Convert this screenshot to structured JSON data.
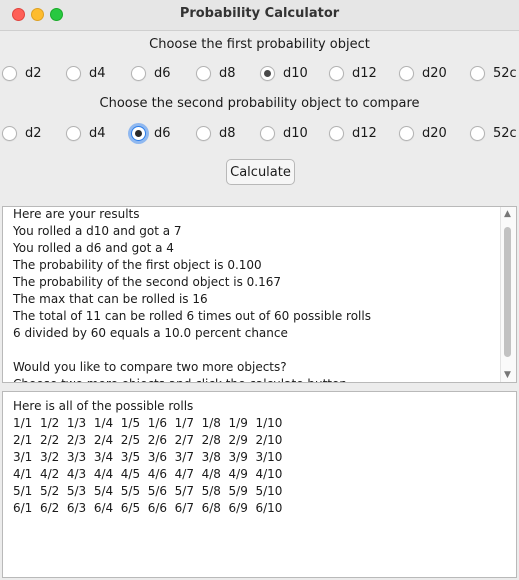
{
  "window": {
    "title": "Probability Calculator"
  },
  "first": {
    "heading": "Choose the first probability object",
    "options": [
      "d2",
      "d4",
      "d6",
      "d8",
      "d10",
      "d12",
      "d20",
      "52c"
    ],
    "selected": "d10"
  },
  "second": {
    "heading": "Choose the second probability object to compare",
    "options": [
      "d2",
      "d4",
      "d6",
      "d8",
      "d10",
      "d12",
      "d20",
      "52c"
    ],
    "selected": "d6"
  },
  "calculate_label": "Calculate",
  "results": [
    "Here are your results",
    "You rolled a d10 and got a 7",
    "You rolled a d6 and got a 4",
    "The probability of the first object is 0.100",
    "The probability of the second object is 0.167",
    "The max that can be rolled is 16",
    "The total of 11 can be rolled 6 times out of 60 possible rolls",
    "6 divided by 60 equals a 10.0 percent chance",
    "",
    "Would you like to compare two more objects?",
    "Choose two more objects and click the calculate button"
  ],
  "rolls": [
    "Here is all of the possible rolls",
    "1/1  1/2  1/3  1/4  1/5  1/6  1/7  1/8  1/9  1/10",
    "2/1  2/2  2/3  2/4  2/5  2/6  2/7  2/8  2/9  2/10",
    "3/1  3/2  3/3  3/4  3/5  3/6  3/7  3/8  3/9  3/10",
    "4/1  4/2  4/3  4/4  4/5  4/6  4/7  4/8  4/9  4/10",
    "5/1  5/2  5/3  5/4  5/5  5/6  5/7  5/8  5/9  5/10",
    "6/1  6/2  6/3  6/4  6/5  6/6  6/7  6/8  6/9  6/10"
  ]
}
